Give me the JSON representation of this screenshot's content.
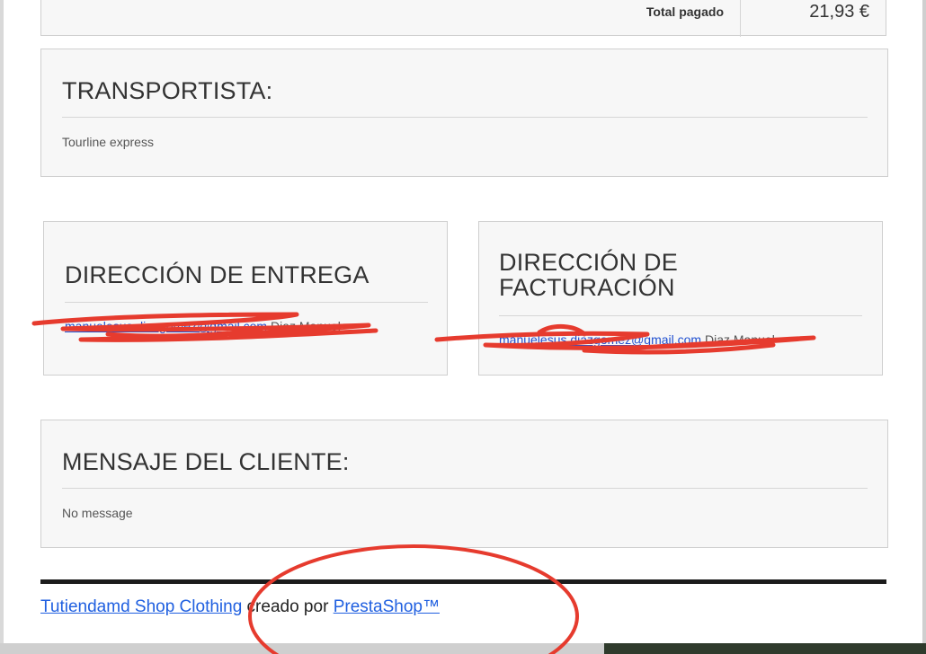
{
  "totals": {
    "label": "Total pagado",
    "value": "21,93 €"
  },
  "carrier": {
    "title": "TRANSPORTISTA:",
    "name": "Tourline express"
  },
  "shipping": {
    "title": "DIRECCIÓN DE ENTREGA",
    "email": "manuelesus.diazgomez@gmail.com",
    "name": "Diaz Manuel"
  },
  "billing": {
    "title_line1": "DIRECCIÓN DE",
    "title_line2": "FACTURACIÓN",
    "email": "manuelesus.diazgomez@gmail.com",
    "name": "Diaz Manuel"
  },
  "message": {
    "title": "MENSAJE DEL CLIENTE:",
    "text": "No message"
  },
  "footer": {
    "shop_link": "Tutiendamd Shop Clothing",
    "middle": " creado por ",
    "platform_link": "PrestaShop™"
  },
  "colors": {
    "annotation": "#e63b2e",
    "link": "#1f5fe0"
  }
}
